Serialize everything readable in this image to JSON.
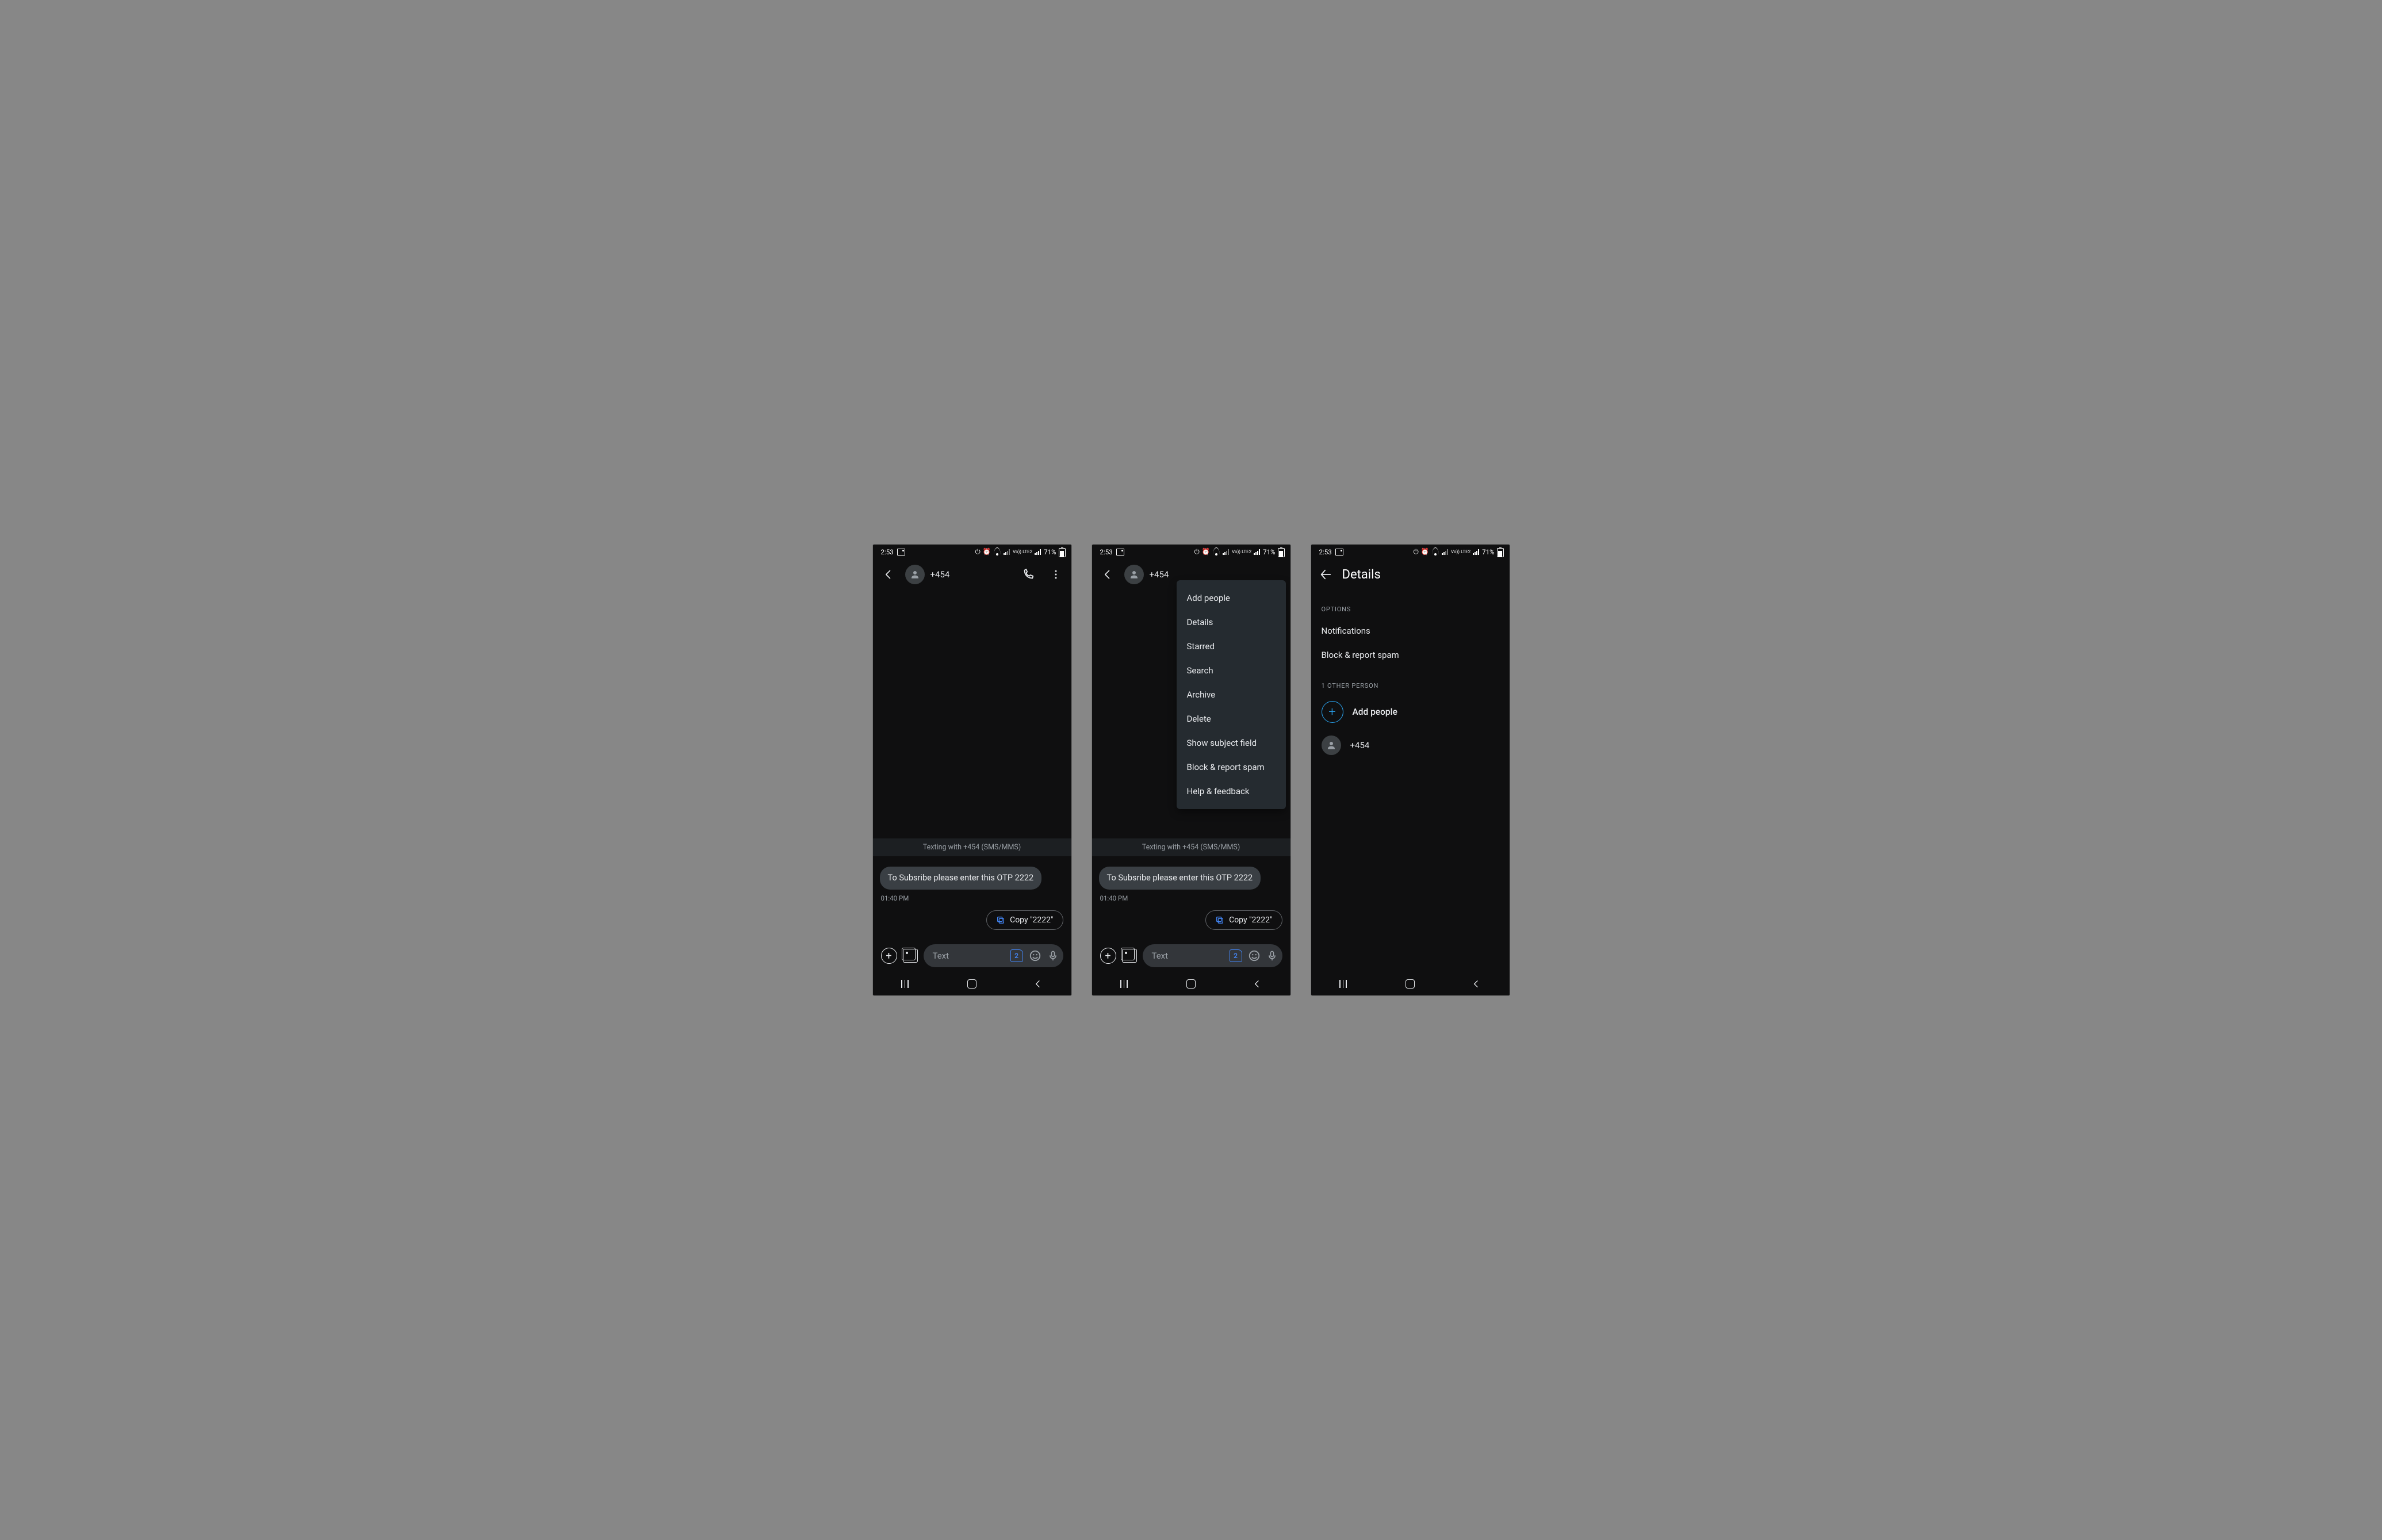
{
  "status": {
    "time": "2:53",
    "volte": "Vo)) LTE2",
    "battery_pct": "71%"
  },
  "chat": {
    "contact": "+454",
    "strip": "Texting with +454 (SMS/MMS)",
    "bubble_text": "To Subsribe please enter this OTP 2222",
    "bubble_time": "01:40 PM",
    "copy_label": "Copy \"2222\"",
    "composer_placeholder": "Text",
    "sim_slot": "2"
  },
  "menu": {
    "items": [
      "Add people",
      "Details",
      "Starred",
      "Search",
      "Archive",
      "Delete",
      "Show subject field",
      "Block & report spam",
      "Help & feedback"
    ]
  },
  "details": {
    "title": "Details",
    "options_header": "OPTIONS",
    "options": [
      "Notifications",
      "Block & report spam"
    ],
    "people_header": "1 OTHER PERSON",
    "add_people": "Add people",
    "person": "+454"
  }
}
